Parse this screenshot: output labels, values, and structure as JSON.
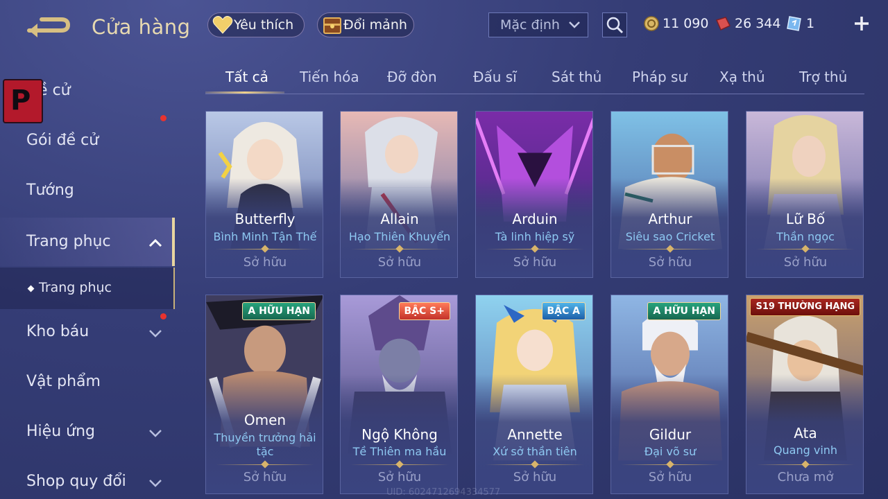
{
  "header": {
    "title": "Cửa hàng",
    "favorite_label": "Yêu thích",
    "shard_label": "Đổi mảnh",
    "sort_label": "Mặc định",
    "gold": "11 090",
    "vouchers": "26 344",
    "tickets": "1"
  },
  "sidebar": {
    "items": [
      {
        "label": "Đề cử"
      },
      {
        "label": "Gói đề cử"
      },
      {
        "label": "Tướng"
      },
      {
        "label": "Trang phục"
      },
      {
        "label": "Trang phục"
      },
      {
        "label": "Kho báu"
      },
      {
        "label": "Vật phẩm"
      },
      {
        "label": "Hiệu ứng"
      },
      {
        "label": "Shop quy đổi"
      }
    ]
  },
  "tabs": [
    "Tất cả",
    "Tiến hóa",
    "Đỡ đòn",
    "Đấu sĩ",
    "Sát thủ",
    "Pháp sư",
    "Xạ thủ",
    "Trợ thủ"
  ],
  "cards": [
    {
      "name": "Butterfly",
      "skin": "Bình Minh Tận Thế",
      "status": "Sở hữu",
      "badge": ""
    },
    {
      "name": "Allain",
      "skin": "Hạo Thiên Khuyển",
      "status": "Sở hữu",
      "badge": ""
    },
    {
      "name": "Arduin",
      "skin": "Tà linh hiệp sỹ",
      "status": "Sở hữu",
      "badge": ""
    },
    {
      "name": "Arthur",
      "skin": "Siêu sao Cricket",
      "status": "Sở hữu",
      "badge": ""
    },
    {
      "name": "Lữ Bố",
      "skin": "Thần ngọc",
      "status": "Sở hữu",
      "badge": ""
    },
    {
      "name": "Omen",
      "skin": "Thuyền trưởng hải tặc",
      "status": "Sở hữu",
      "badge": "A HỮU HẠN"
    },
    {
      "name": "Ngộ Không",
      "skin": "Tề Thiên ma hầu",
      "status": "Sở hữu",
      "badge": "BẬC S+"
    },
    {
      "name": "Annette",
      "skin": "Xứ sở thần tiên",
      "status": "Sở hữu",
      "badge": "BẬC A"
    },
    {
      "name": "Gildur",
      "skin": "Đại võ sư",
      "status": "Sở hữu",
      "badge": "A HỮU HẠN"
    },
    {
      "name": "Ata",
      "skin": "Quang vinh",
      "status": "Chưa mở",
      "badge": "S19 THƯỜNG HẠNG"
    }
  ],
  "uid": "UID: 6024712694334577",
  "colors": {
    "accent_gold": "#e8d6a0",
    "skin_blue": "#8ec9f2",
    "notify_red": "#e8332f"
  }
}
